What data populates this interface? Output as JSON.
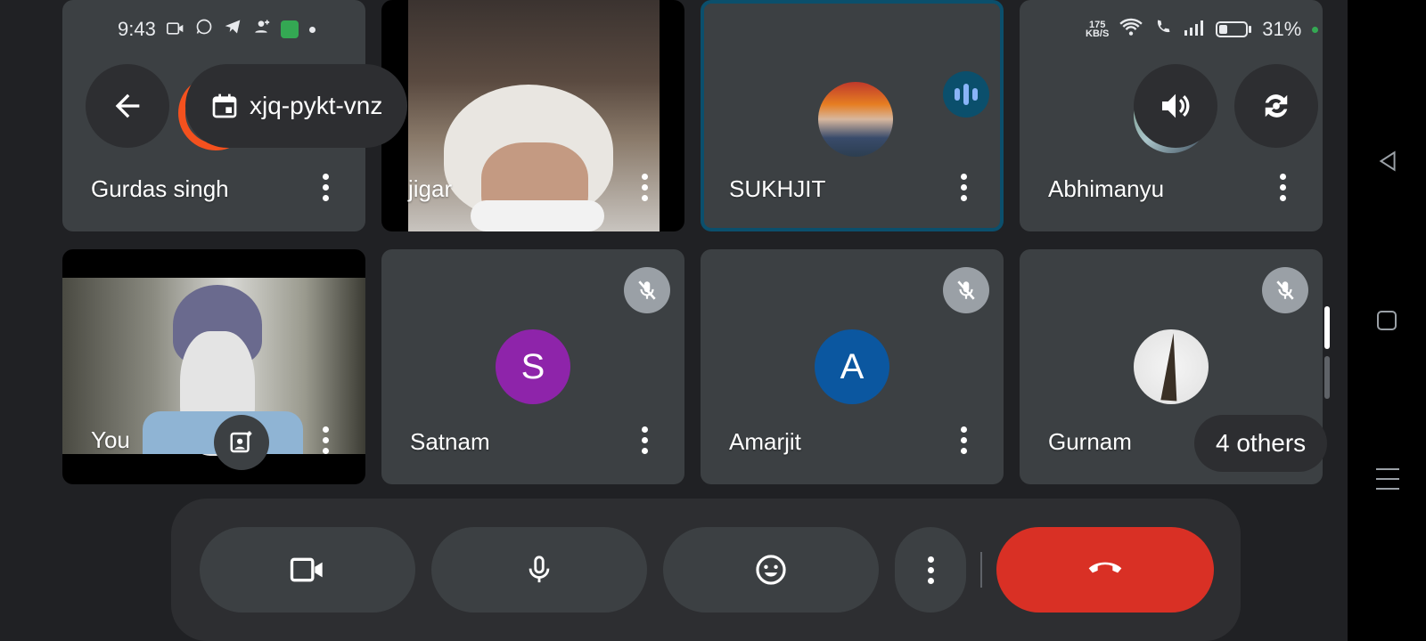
{
  "status_bar": {
    "time": "9:43",
    "left_icons": [
      "video-icon",
      "whatsapp-icon",
      "telegram-icon",
      "person-add-icon",
      "app-icon",
      "dot-icon"
    ],
    "net_speed_value": "175",
    "net_speed_unit": "KB/S",
    "battery_percent": "31%",
    "right_icons": [
      "wifi-icon",
      "wifi-call-icon",
      "signal-icon",
      "battery-icon"
    ]
  },
  "meeting": {
    "code": "xjq-pykt-vnz",
    "code_icon": "calendar-icon"
  },
  "participants": [
    {
      "name": "Gurdas singh"
    },
    {
      "name": "jigar"
    },
    {
      "name": "SUKHJIT",
      "speaking": true
    },
    {
      "name": "Abhimanyu"
    },
    {
      "name": "You"
    },
    {
      "name": "Satnam",
      "initial": "S",
      "avatar_color": "#8e24aa",
      "muted": true
    },
    {
      "name": "Amarjit",
      "initial": "A",
      "avatar_color": "#0b57a0",
      "muted": true
    },
    {
      "name": "Gurnam",
      "muted": true
    }
  ],
  "others_label": "4 others",
  "controls": {
    "camera_icon": "camera-icon",
    "mic_icon": "microphone-icon",
    "emoji_icon": "emoji-icon",
    "more_icon": "more-vert-icon",
    "end_call_icon": "end-call-icon",
    "end_call_color": "#d93025"
  },
  "colors": {
    "background": "#202124",
    "tile": "#3c4043",
    "speaking_border": "#0b4f6c",
    "accent_orange": "#f4511e"
  }
}
